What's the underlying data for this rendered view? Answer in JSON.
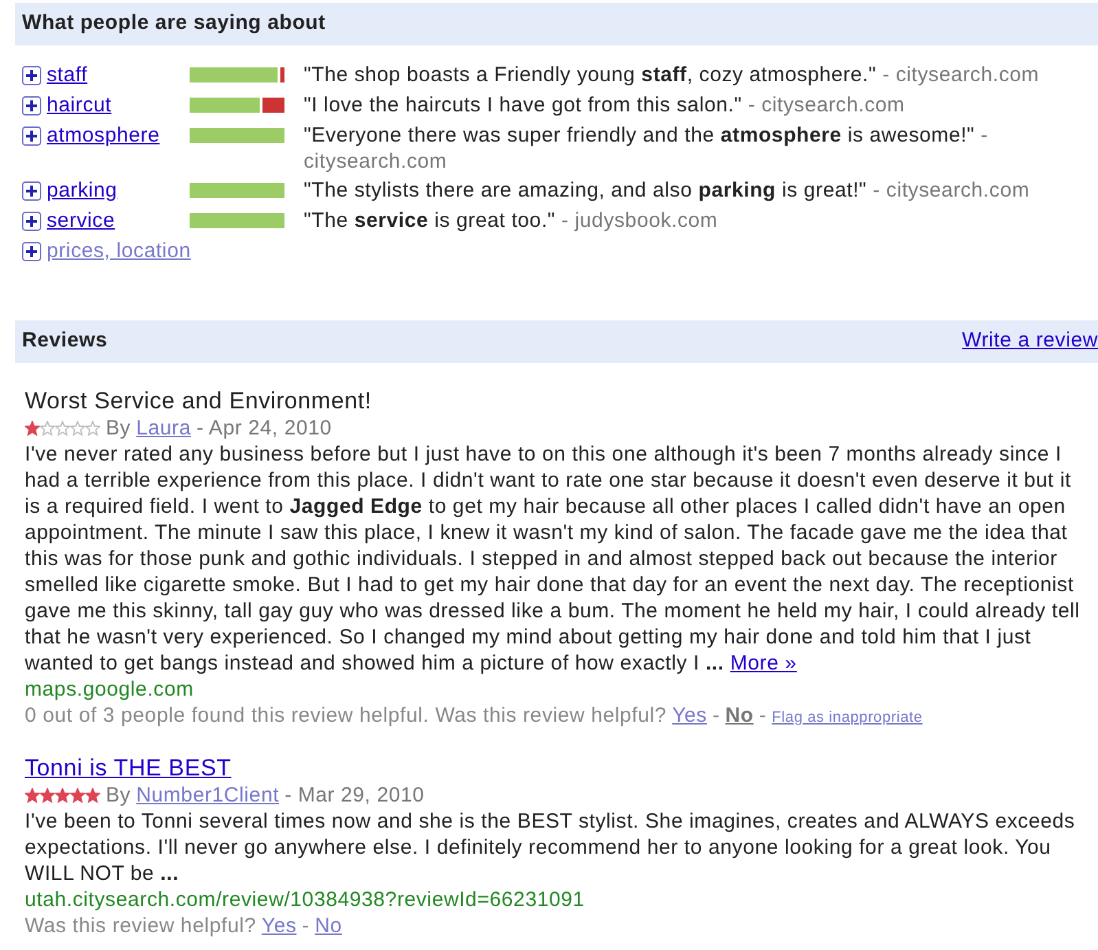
{
  "summary": {
    "title": "What people are saying about",
    "topics": [
      {
        "label": "staff",
        "visited": false,
        "level": 0.93,
        "quote": "\"The shop boasts a Friendly young **staff**, cozy atmosphere.\"",
        "source": "- citysearch.com"
      },
      {
        "label": "haircut",
        "visited": false,
        "level": 0.74,
        "quote": "\"I love the haircuts I have got from this salon.\"",
        "source": "- citysearch.com"
      },
      {
        "label": "atmosphere",
        "visited": false,
        "level": 1,
        "quote": "\"Everyone there was super friendly and the **atmosphere** is awesome!\"",
        "source": "- citysearch.com"
      },
      {
        "label": "parking",
        "visited": false,
        "level": 1,
        "quote": "\"The stylists there are amazing, and also **parking** is great!\"",
        "source": "- citysearch.com"
      },
      {
        "label": "service",
        "visited": false,
        "level": 1,
        "quote": "\"The **service** is great too.\"",
        "source": "- judysbook.com"
      },
      {
        "label": "prices, location",
        "visited": true
      }
    ]
  },
  "reviews": {
    "title": "Reviews",
    "write_link": "Write a review",
    "items": [
      {
        "title": "Worst Service and Environment!",
        "title_link": false,
        "stars": 1,
        "by": "By",
        "author": "Laura",
        "date": "- Apr 24, 2010",
        "body": "I've never rated any business before but I just have to on this one although it's been 7 months already since I had a terrible experience from this place. I didn't want to rate one star because it doesn't even deserve it but it is a required field. I went to **Jagged Edge** to get my hair because all other places I called didn't have an open appointment. The minute I saw this place, I knew it wasn't my kind of salon. The facade gave me the idea that this was for those punk and gothic individuals. I stepped in and almost stepped back out because the interior smelled like cigarette smoke. But I had to get my hair done that day for an event the next day. The receptionist gave me this skinny, tall gay guy who was dressed like a bum. The moment he held my hair, I could already tell that he wasn't very experienced. So I changed my mind about getting my hair done and told him that I just wanted to get bangs instead and showed him a picture of how exactly I **...**",
        "more": "More »",
        "url": "maps.google.com",
        "helpful": [
          {
            "kind": "text",
            "text": "0 out of 3 people found this review helpful. Was this review helpful?"
          },
          {
            "kind": "vote",
            "text": "Yes",
            "selected": false
          },
          {
            "kind": "sep",
            "text": "-"
          },
          {
            "kind": "vote",
            "text": "No",
            "selected": true
          },
          {
            "kind": "sep",
            "text": "-"
          },
          {
            "kind": "flag",
            "text": "Flag as inappropriate"
          }
        ]
      },
      {
        "title": "Tonni is THE BEST",
        "title_link": true,
        "stars": 5,
        "by": "By",
        "author": "Number1Client",
        "date": "- Mar 29, 2010",
        "body": "I've been to Tonni several times now and she is the BEST stylist. She imagines, creates and ALWAYS exceeds expectations. I'll never go anywhere else. I definitely recommend her to anyone looking for a great look. You WILL NOT be **...**",
        "url": "utah.citysearch.com/review/10384938?reviewId=66231091",
        "helpful": [
          {
            "kind": "text",
            "text": "Was this review helpful?"
          },
          {
            "kind": "vote",
            "text": "Yes",
            "selected": false
          },
          {
            "kind": "sep",
            "text": "-"
          },
          {
            "kind": "vote",
            "text": "No",
            "selected": false
          }
        ]
      }
    ]
  }
}
